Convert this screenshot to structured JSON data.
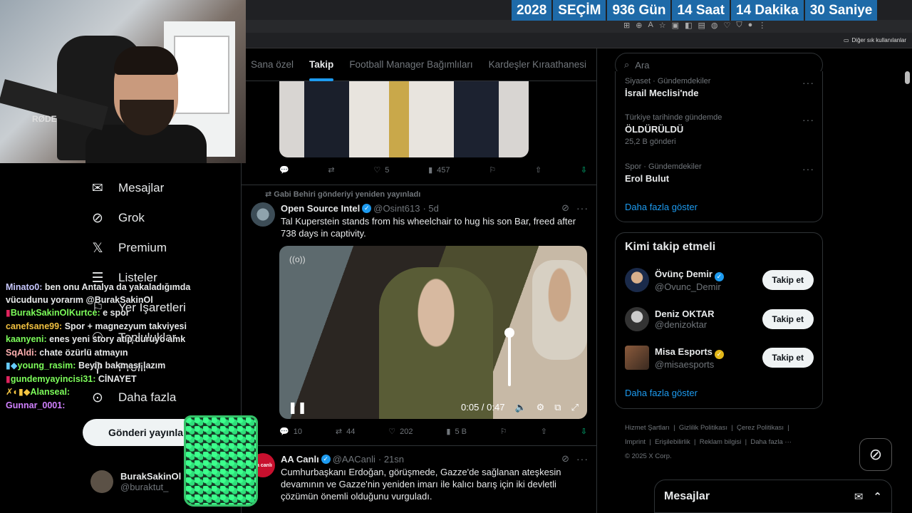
{
  "countdown": {
    "year": "2028",
    "label": "SEÇİM",
    "days": "936 Gün",
    "hours": "14 Saat",
    "minutes": "14 Dakika",
    "seconds": "30 Saniye",
    "color": "#1e6aa8"
  },
  "browser": {
    "bookmarks_label": "Diğer sık kullanılanlar"
  },
  "webcam": {
    "mic_brand": "RØDE"
  },
  "nav": {
    "items": [
      {
        "label": "Mesajlar",
        "icon": "envelope-icon"
      },
      {
        "label": "Grok",
        "icon": "grok-icon"
      },
      {
        "label": "Premium",
        "icon": "x-logo-icon"
      },
      {
        "label": "Listeler",
        "icon": "list-icon"
      },
      {
        "label": "Yer İşaretleri",
        "icon": "bookmark-icon"
      },
      {
        "label": "Topluluklar",
        "icon": "people-icon"
      },
      {
        "label": "Profil",
        "icon": "person-icon"
      },
      {
        "label": "Daha fazla",
        "icon": "more-circle-icon"
      }
    ],
    "post_button": "Gönderi yayınla",
    "account": {
      "name": "BurakSakinOl",
      "handle": "@buraktut_"
    }
  },
  "chat": [
    {
      "user": "Minato0:",
      "text": "ben onu Antalya da yakaladığımda vücudunu yorarım @BurakSakinOl",
      "color": "#c8c8ff"
    },
    {
      "user": "BurakSakinOlKurtce:",
      "text": "e spor",
      "color": "#7cfc5a"
    },
    {
      "user": "canefsane99:",
      "text": "Spor + magnezyum takviyesi",
      "color": "#f0c040"
    },
    {
      "user": "kaanyeni:",
      "text": "enes yeni story atıp duruyo amk",
      "color": "#7cfc5a"
    },
    {
      "user": "SqAldi:",
      "text": "chate özürlü atmayın",
      "color": "#ffb0b0"
    },
    {
      "user": "young_rasim:",
      "text": "Beyin bakması lazım",
      "color": "#7cfc5a"
    },
    {
      "user": "gundemyayincisi31:",
      "text": "CİNAYET",
      "color": "#7cfc5a"
    },
    {
      "user": "Alanseal:",
      "text": "",
      "color": "#7cfc5a"
    },
    {
      "user": "Gunnar_0001:",
      "text": "",
      "color": "#d080ff"
    }
  ],
  "feed": {
    "tabs": [
      "Sana özel",
      "Takip",
      "Football Manager Bağımlıları",
      "Kardeşler Kıraathanesi"
    ],
    "active_tab": "Takip",
    "post0_stats": {
      "likes": "5",
      "views": "457"
    },
    "repost_label": "Gabi Behiri gönderiyi yeniden yayınladı",
    "post1": {
      "name": "Open Source Intel",
      "handle": "@Osint613",
      "time": "· 5d",
      "text": "Tal Kuperstein stands from his wheelchair to hug his son Bar, freed after 738 days in captivity.",
      "video_time": "0:05 / 0:47",
      "stats": {
        "replies": "10",
        "reposts": "44",
        "likes": "202",
        "views": "5 B"
      }
    },
    "post2": {
      "name": "AA Canlı",
      "handle": "@AACanli",
      "time": "· 21sn",
      "text": "Cumhurbaşkanı Erdoğan, görüşmede, Gazze'de sağlanan ateşkesin devamının ve Gazze'nin yeniden imarı ile kalıcı barış için iki devletli çözümün önemli olduğunu vurguladı.",
      "avatar_label": "aa canlı"
    }
  },
  "right": {
    "search_placeholder": "Ara",
    "trends": [
      {
        "meta": "Siyaset · Gündemdekiler",
        "title": "İsrail Meclisi'nde",
        "count": ""
      },
      {
        "meta": "Türkiye tarihinde gündemde",
        "title": "ÖLDÜRÜLDÜ",
        "count": "25,2 B gönderi"
      },
      {
        "meta": "Spor · Gündemdekiler",
        "title": "Erol Bulut",
        "count": ""
      }
    ],
    "show_more": "Daha fazla göster",
    "who_title": "Kimi takip etmeli",
    "who": [
      {
        "name": "Övünç Demir",
        "handle": "@Ovunc_Demir",
        "badge": "blue"
      },
      {
        "name": "Deniz OKTAR",
        "handle": "@denizoktar",
        "badge": ""
      },
      {
        "name": "Misa Esports",
        "handle": "@misaesports",
        "badge": "gold"
      }
    ],
    "follow_label": "Takip et",
    "footer": [
      "Hizmet Şartları",
      "Gizlilik Politikası",
      "Çerez Politikası",
      "Imprint",
      "Erişilebilirlik",
      "Reklam bilgisi",
      "Daha fazla ···",
      "© 2025 X Corp."
    ],
    "messages_dock": "Mesajlar"
  },
  "colors": {
    "accent": "#1d9bf0",
    "bg": "#000000",
    "text": "#e7e9ea",
    "muted": "#71767b"
  }
}
